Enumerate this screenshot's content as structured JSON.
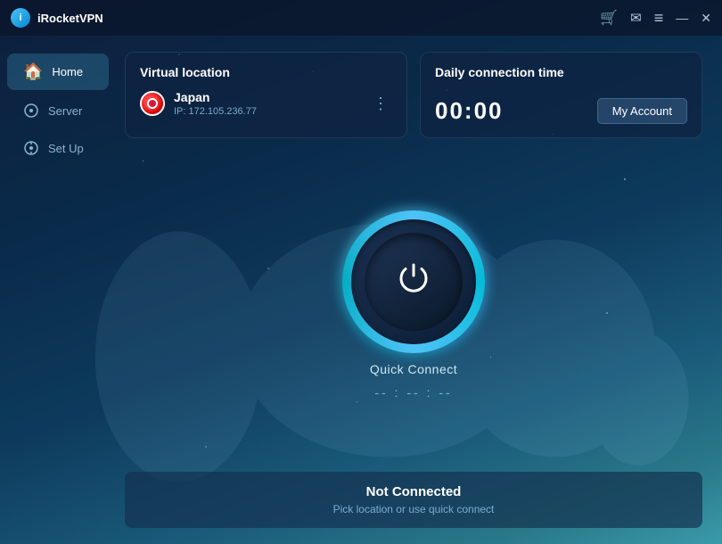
{
  "app": {
    "name": "iRocketVPN",
    "logo_letter": "i"
  },
  "titlebar": {
    "cart_icon": "🛒",
    "mail_icon": "✉",
    "menu_icon": "≡",
    "minimize_icon": "—",
    "close_icon": "✕"
  },
  "sidebar": {
    "items": [
      {
        "id": "home",
        "label": "Home",
        "icon": "🏠",
        "active": true
      },
      {
        "id": "server",
        "label": "Server",
        "icon": "⊙",
        "active": false
      },
      {
        "id": "setup",
        "label": "Set Up",
        "icon": "⊙",
        "active": false
      }
    ]
  },
  "virtual_location": {
    "title": "Virtual location",
    "country": "Japan",
    "ip": "IP: 172.105.236.77"
  },
  "daily_time": {
    "title": "Daily connection time",
    "time": "00:00",
    "my_account": "My Account"
  },
  "power": {
    "label": "Quick Connect",
    "timer": "-- : -- : --"
  },
  "status": {
    "title": "Not Connected",
    "subtitle": "Pick location or use quick connect"
  }
}
